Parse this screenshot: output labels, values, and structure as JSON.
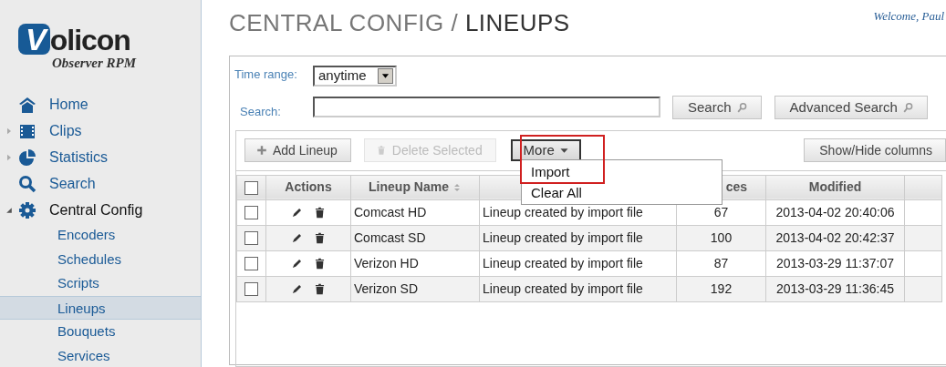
{
  "logo": {
    "mark": "V",
    "name": "olicon",
    "tagline": "Observer RPM"
  },
  "welcome": "Welcome, Paul",
  "page_title": {
    "section": "CENTRAL CONFIG",
    "separator": "/",
    "page": "LINEUPS"
  },
  "sidebar": {
    "items": [
      {
        "label": "Home"
      },
      {
        "label": "Clips",
        "expanded": false
      },
      {
        "label": "Statistics",
        "expanded": false
      },
      {
        "label": "Search"
      },
      {
        "label": "Central Config",
        "expanded": true,
        "children": [
          {
            "label": "Encoders",
            "selected": false
          },
          {
            "label": "Schedules",
            "selected": false
          },
          {
            "label": "Scripts",
            "selected": false
          },
          {
            "label": "Lineups",
            "selected": true
          },
          {
            "label": "Bouquets",
            "selected": false
          },
          {
            "label": "Services",
            "selected": false
          }
        ]
      }
    ]
  },
  "filters": {
    "time_range": {
      "label": "Time range:",
      "value": "anytime"
    },
    "search": {
      "label": "Search:"
    },
    "buttons": [
      {
        "label": "Search"
      },
      {
        "label": "Advanced Search"
      }
    ]
  },
  "toolbar": {
    "buttons": [
      {
        "label": "Add Lineup",
        "disabled": false
      },
      {
        "label": "Delete Selected",
        "disabled": true
      }
    ],
    "more": {
      "label": "More",
      "open": true,
      "items": [
        {
          "label": "Import",
          "highlighted": true
        },
        {
          "label": "Clear All",
          "highlighted": false
        }
      ]
    },
    "columns_button": "Show/Hide columns"
  },
  "table": {
    "columns": [
      {
        "kind": "checkbox",
        "checked": false
      },
      {
        "label": "Actions"
      },
      {
        "label": "Lineup Name",
        "sortable": true
      },
      {
        "kind": "blank"
      },
      {
        "label": "ces"
      },
      {
        "label": "Modified"
      },
      {
        "kind": "blank"
      }
    ],
    "rows": [
      {
        "checked": false,
        "name": "Comcast HD",
        "description": "Lineup created by import file",
        "services": "67",
        "modified": "2013-04-02 20:40:06"
      },
      {
        "checked": false,
        "name": "Comcast SD",
        "description": "Lineup created by import file",
        "services": "100",
        "modified": "2013-04-02 20:42:37"
      },
      {
        "checked": false,
        "name": "Verizon HD",
        "description": "Lineup created by import file",
        "services": "87",
        "modified": "2013-03-29 11:37:07"
      },
      {
        "checked": false,
        "name": "Verizon SD",
        "description": "Lineup created by import file",
        "services": "192",
        "modified": "2013-03-29 11:36:45"
      }
    ]
  }
}
